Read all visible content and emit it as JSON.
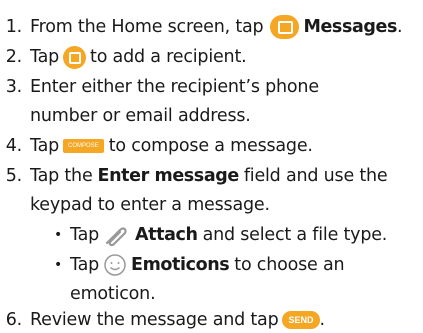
{
  "steps": [
    {
      "num": "1.",
      "a": "From the Home screen, tap",
      "icon": "messages-icon",
      "b": "Messages",
      "c": "."
    },
    {
      "num": "2.",
      "a": "Tap",
      "icon": "compose-icon",
      "b": "to add a recipient."
    },
    {
      "num": "3.",
      "a": "Enter either the recipient’s phone",
      "cont": "number or email address."
    },
    {
      "num": "4.",
      "a": "Tap",
      "button": "COMPOSE",
      "b": "to compose a message."
    },
    {
      "num": "5.",
      "a": "Tap the",
      "bold": "Enter message",
      "b": "field and use the",
      "cont": "keypad to enter a message."
    },
    {
      "num": "6.",
      "a": "Review the message and tap",
      "button": "SEND",
      "c": "."
    }
  ],
  "bullets": [
    {
      "a": "Tap",
      "icon": "paperclip-icon",
      "bold": "Attach",
      "b": "and select a file type."
    },
    {
      "a": "Tap",
      "icon": "emoticon-icon",
      "bold": "Emoticons",
      "b": "to choose an",
      "cont": "emoticon."
    }
  ],
  "colors": {
    "accent": "#f5a623"
  }
}
